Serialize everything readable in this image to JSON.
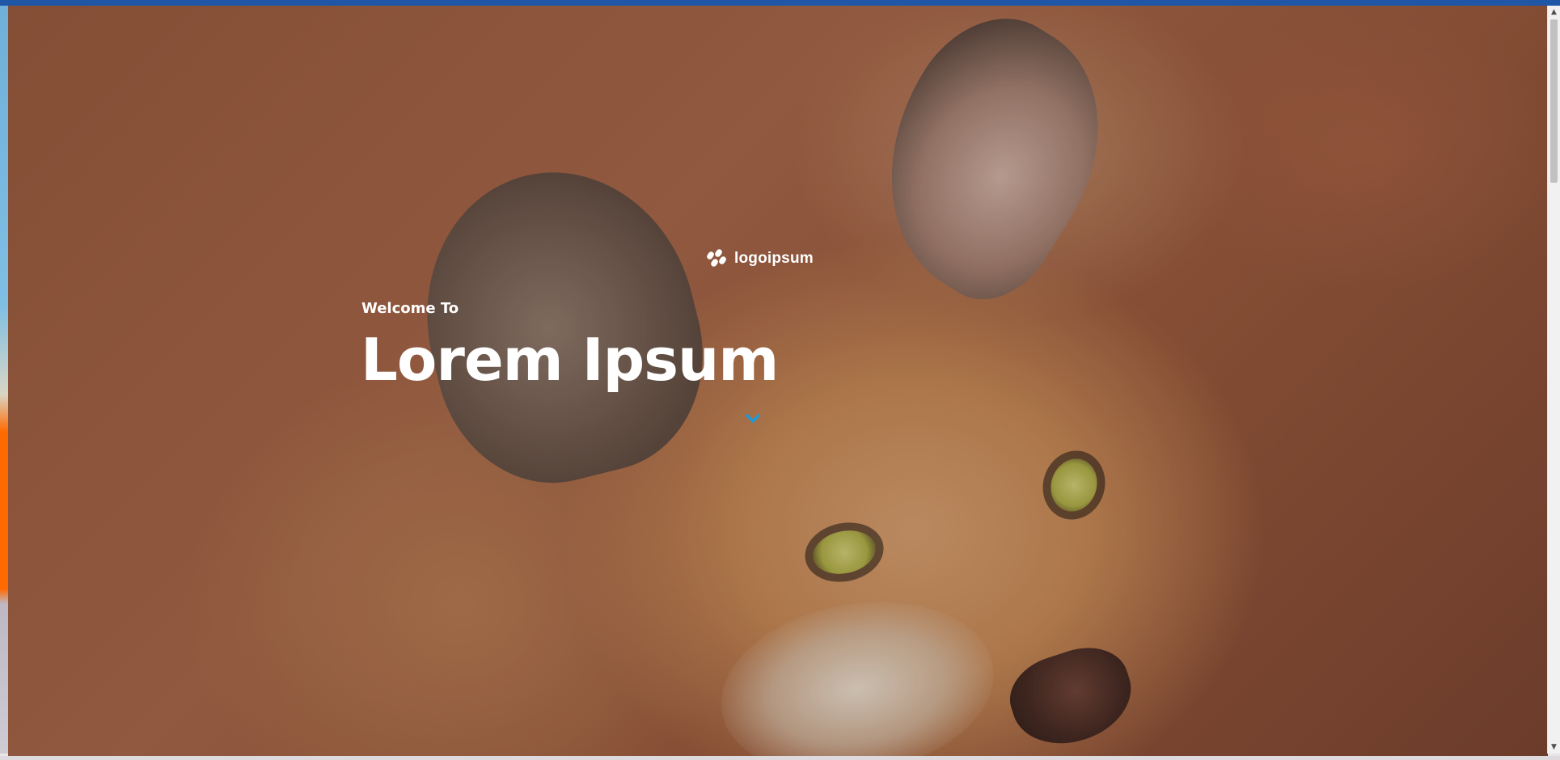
{
  "window": {
    "accent_color": "#1f56a6"
  },
  "hero": {
    "image_icon": "caracal-photo",
    "logo": {
      "icon": "logo-mark-icon",
      "text": "logoipsum"
    },
    "welcome": "Welcome To",
    "title": "Lorem Ipsum",
    "scroll_icon": "chevron-down-icon",
    "scroll_icon_color": "#1e9bd7"
  },
  "scrollbar": {
    "up_icon": "scroll-up-arrow-icon",
    "down_icon": "scroll-down-arrow-icon"
  }
}
